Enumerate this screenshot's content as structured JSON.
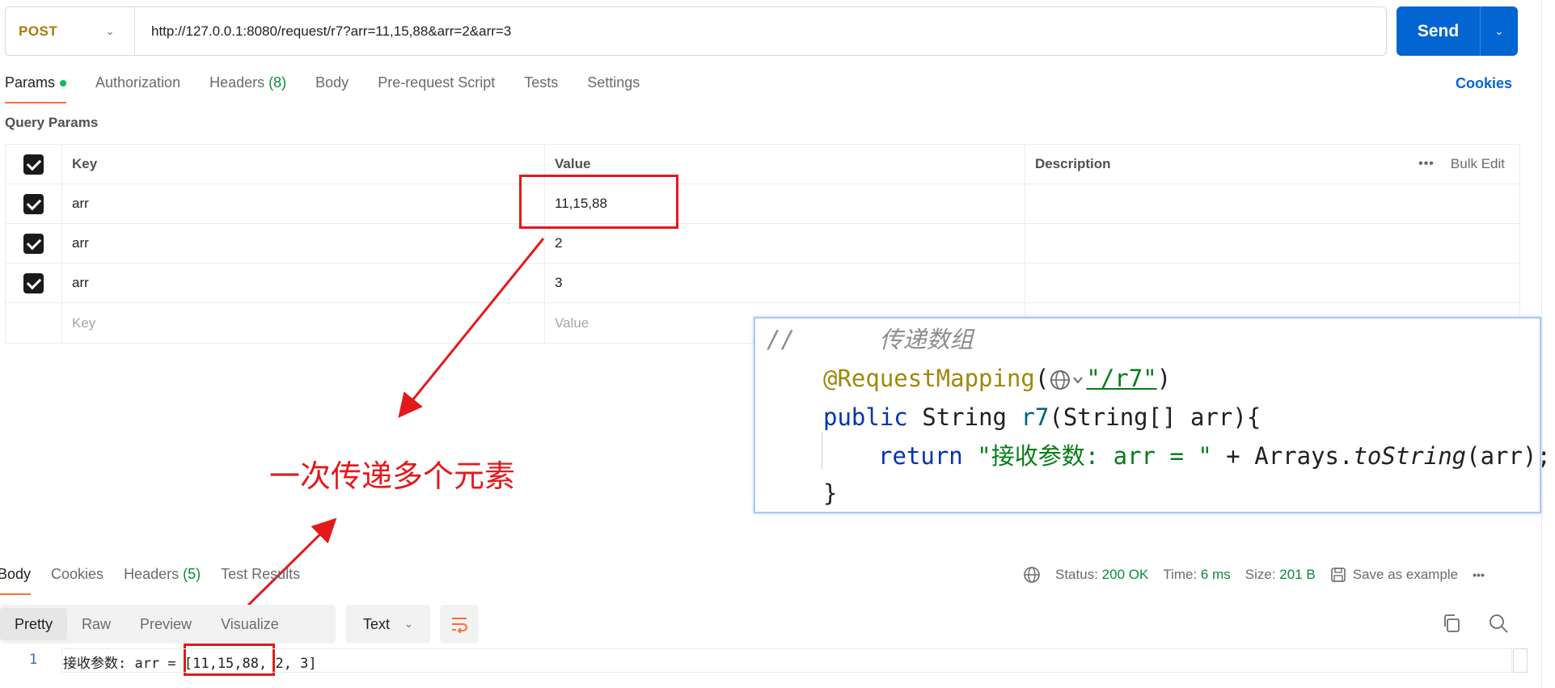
{
  "request": {
    "method": "POST",
    "url": "http://127.0.0.1:8080/request/r7?arr=11,15,88&arr=2&arr=3",
    "send_label": "Send"
  },
  "request_tabs": [
    {
      "label": "Params",
      "active": true,
      "dot": true
    },
    {
      "label": "Authorization"
    },
    {
      "label": "Headers",
      "count": "(8)"
    },
    {
      "label": "Body"
    },
    {
      "label": "Pre-request Script"
    },
    {
      "label": "Tests"
    },
    {
      "label": "Settings"
    }
  ],
  "cookies_label": "Cookies",
  "query_params": {
    "title": "Query Params",
    "headers": {
      "key": "Key",
      "value": "Value",
      "description": "Description",
      "bulk_edit": "Bulk Edit",
      "more": "•••"
    },
    "rows": [
      {
        "key": "arr",
        "value": "11,15,88",
        "checked": true
      },
      {
        "key": "arr",
        "value": "2",
        "checked": true
      },
      {
        "key": "arr",
        "value": "3",
        "checked": true
      }
    ],
    "placeholder": {
      "key": "Key",
      "value": "Value"
    }
  },
  "annotation": {
    "text": "一次传递多个元素",
    "color": "#e3191c"
  },
  "code_snippet": {
    "comment": "//      传递数组",
    "annotation": "@RequestMapping",
    "mapping_path": "\"/r7\"",
    "kw_public": "public",
    "type_string": "String",
    "method_name": "r7",
    "params": "(String[] arr){",
    "kw_return": "return",
    "return_str": "\"接收参数: arr = \"",
    "plus": " + ",
    "arrays": "Arrays.",
    "to_string": "toString",
    "call_end": "(arr);",
    "close_brace": "}"
  },
  "response": {
    "tabs": [
      {
        "label": "Body",
        "active": true
      },
      {
        "label": "Cookies"
      },
      {
        "label": "Headers",
        "count": "(5)"
      },
      {
        "label": "Test Results"
      }
    ],
    "status_label": "Status:",
    "status_value": "200 OK",
    "time_label": "Time:",
    "time_value": "6 ms",
    "size_label": "Size:",
    "size_value": "201 B",
    "save_example": "Save as example",
    "more": "•••",
    "view_options": [
      "Pretty",
      "Raw",
      "Preview",
      "Visualize"
    ],
    "active_view": "Pretty",
    "format": "Text",
    "body_line_number": "1",
    "body_text": "接收参数: arr = [11,15,88, 2, 3]"
  },
  "colors": {
    "send": "#0265d2",
    "method": "#ad7a03",
    "accent_tab": "#ff6c37",
    "status_green": "#0a8a3a",
    "cookies_link": "#0265d2"
  }
}
